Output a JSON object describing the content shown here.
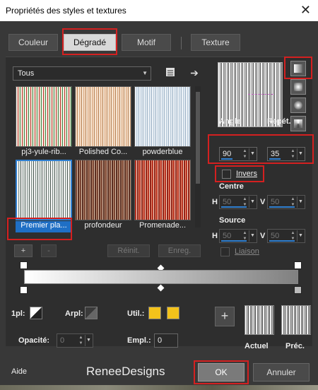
{
  "window": {
    "title": "Propriétés des styles et textures",
    "close_glyph": "✕"
  },
  "tabs": [
    {
      "label": "Couleur"
    },
    {
      "label": "Dégradé"
    },
    {
      "label": "Motif"
    },
    {
      "label": "Texture"
    }
  ],
  "category": {
    "value": "Tous"
  },
  "gradients": [
    {
      "label": "pj3-yule-rib...",
      "colors": [
        "#f5f0e6",
        "#c0332c",
        "#e9e2cf",
        "#3c8a4a"
      ]
    },
    {
      "label": "Polished Co...",
      "colors": [
        "#f2d6bd",
        "#b78458",
        "#f6e6d4",
        "#d7a57c"
      ]
    },
    {
      "label": "powderblue",
      "colors": [
        "#eef3f8",
        "#b6c8d8",
        "#dfe8f0",
        "#9fb3c6"
      ]
    },
    {
      "label": "Premier pla...",
      "colors": [
        "#f4f4f4",
        "#7c8a84",
        "#e6ebe8",
        "#4d5a54"
      ]
    },
    {
      "label": "profondeur",
      "colors": [
        "#7a4432",
        "#d8c0a9",
        "#5a2e22",
        "#b88d70"
      ]
    },
    {
      "label": "Promenade...",
      "colors": [
        "#b83222",
        "#f2d7c4",
        "#8f241a",
        "#e88d6e"
      ]
    }
  ],
  "library_buttons": {
    "add": "+",
    "remove": "-",
    "reset": "Réinit.",
    "save": "Enreg."
  },
  "angle": {
    "label": "Angle",
    "value": "90"
  },
  "repeat": {
    "label": "Répét.",
    "value": "35"
  },
  "invert": {
    "label": "Invers"
  },
  "center": {
    "label": "Centre",
    "h_label": "H",
    "h_value": "50",
    "v_label": "V",
    "v_value": "50"
  },
  "source": {
    "label": "Source",
    "h_label": "H",
    "h_value": "50",
    "v_label": "V",
    "v_value": "50"
  },
  "link": {
    "label": "Liaison"
  },
  "bottom_controls": {
    "one_pl_label": "1pl:",
    "arpl_label": "Arpl:",
    "util_label": "Util.:",
    "opacity_label": "Opacité:",
    "opacity_value": "0",
    "empl_label": "Empl.:",
    "empl_value": "0",
    "util_color": "#f3c21b"
  },
  "current": {
    "add_glyph": "+",
    "actual_label": "Actuel",
    "previous_label": "Préc."
  },
  "footer": {
    "help": "Aide",
    "brand": "ReneeDesigns",
    "ok": "OK",
    "cancel": "Annuler"
  }
}
